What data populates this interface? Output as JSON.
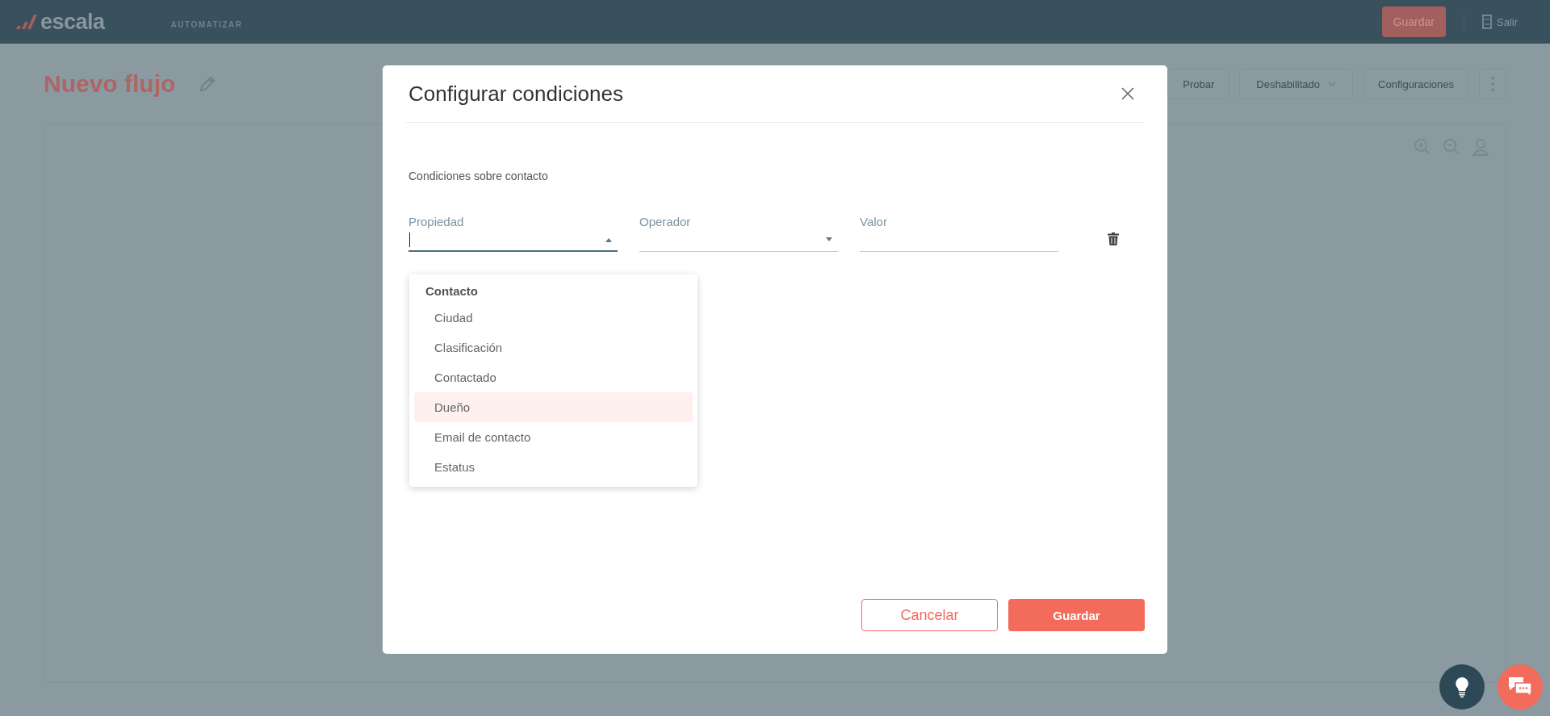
{
  "header": {
    "logo": "escala",
    "nav_item": "AUTOMATIZAR",
    "save_button": "Guardar",
    "logout": "Salir"
  },
  "page": {
    "title": "Nuevo flujo",
    "toolbar": {
      "test_button": "Probar",
      "status_dropdown": "Deshabilitado",
      "settings_button": "Configuraciones"
    }
  },
  "modal": {
    "title": "Configurar condiciones",
    "section_label": "Condiciones sobre contacto",
    "fields": [
      {
        "label": "Propiedad",
        "kind": "select",
        "expanded": true
      },
      {
        "label": "Operador",
        "kind": "select",
        "expanded": false
      },
      {
        "label": "Valor",
        "kind": "text"
      }
    ],
    "dropdown": {
      "group": "Contacto",
      "options": [
        {
          "label": "Ciudad",
          "highlighted": false
        },
        {
          "label": "Clasificación",
          "highlighted": false
        },
        {
          "label": "Contactado",
          "highlighted": false
        },
        {
          "label": "Dueño",
          "highlighted": true
        },
        {
          "label": "Email de contacto",
          "highlighted": false
        },
        {
          "label": "Estatus",
          "highlighted": false
        }
      ]
    },
    "buttons": [
      {
        "label": "Cancelar",
        "kind": "outline"
      },
      {
        "label": "Guardar",
        "kind": "primary"
      }
    ]
  }
}
